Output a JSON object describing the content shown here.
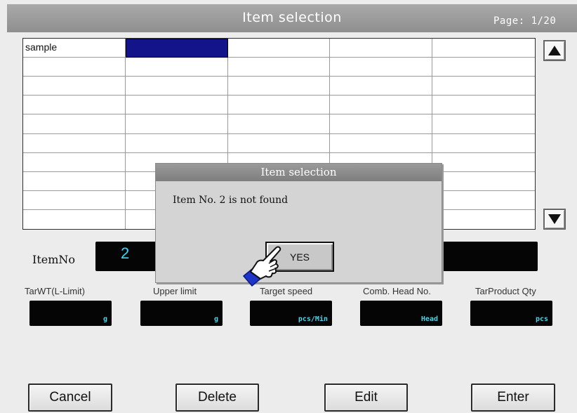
{
  "window": {
    "title": "Item selection",
    "page": "Page: 1/20"
  },
  "grid": {
    "rows": [
      [
        "sample",
        "",
        "",
        "",
        ""
      ],
      [
        "",
        "",
        "",
        "",
        ""
      ],
      [
        "",
        "",
        "",
        "",
        ""
      ],
      [
        "",
        "",
        "",
        "",
        ""
      ],
      [
        "",
        "",
        "",
        "",
        ""
      ],
      [
        "",
        "",
        "",
        "",
        ""
      ],
      [
        "",
        "",
        "",
        "",
        ""
      ],
      [
        "",
        "",
        "",
        "",
        ""
      ],
      [
        "",
        "",
        "",
        "",
        ""
      ],
      [
        "",
        "",
        "",
        "",
        ""
      ]
    ]
  },
  "item_no": {
    "label": "ItemNo",
    "value": "2"
  },
  "params": [
    {
      "label": "TarWT(L-Limit)",
      "unit": "g"
    },
    {
      "label": "Upper limit",
      "unit": "g"
    },
    {
      "label": "Target speed",
      "unit": "pcs/Min"
    },
    {
      "label": "Comb. Head No.",
      "unit": "Head"
    },
    {
      "label": "TarProduct Qty",
      "unit": "pcs"
    }
  ],
  "buttons": {
    "cancel": "Cancel",
    "delete": "Delete",
    "edit": "Edit",
    "enter": "Enter"
  },
  "dialog": {
    "title": "Item selection",
    "message": "Item No. 2 is not found",
    "yes": "YES"
  },
  "colors": {
    "selected_cell": "#14148a",
    "value_text": "#37d7ff",
    "title_bar": "#9a9a9a"
  }
}
